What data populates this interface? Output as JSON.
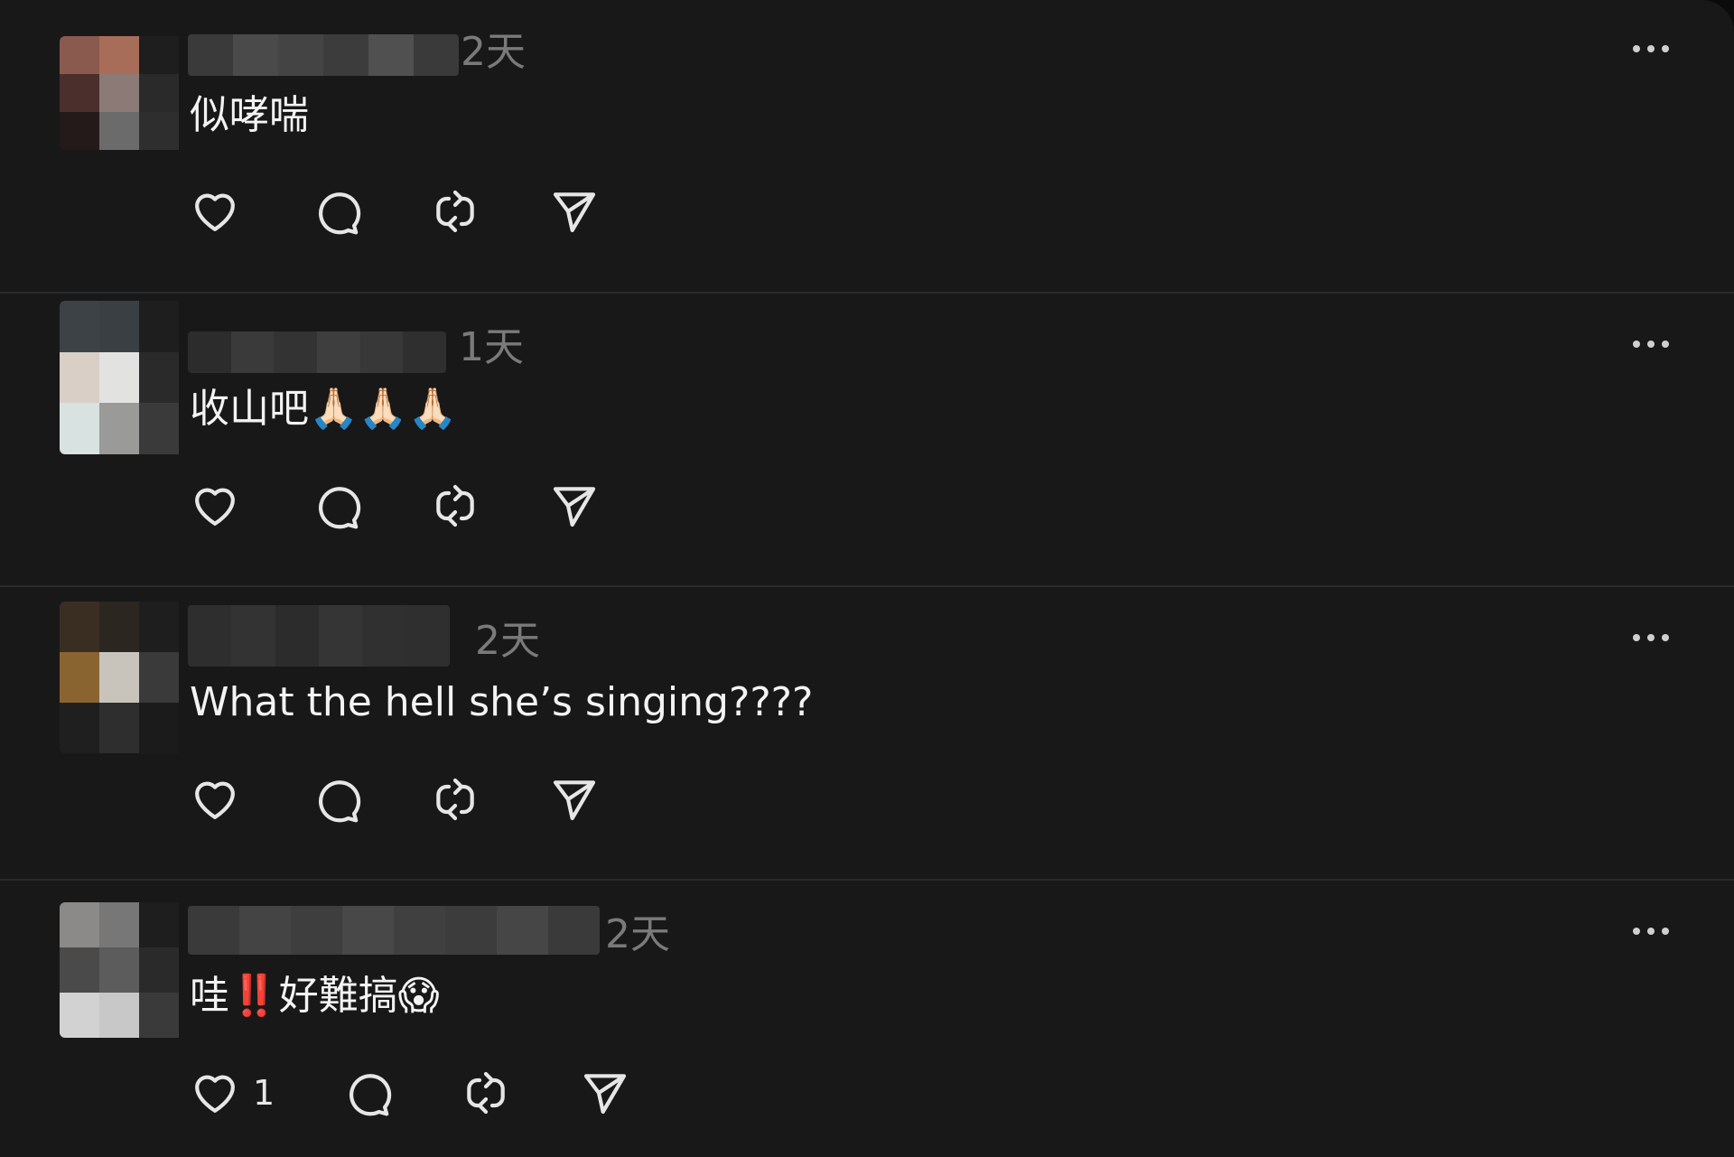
{
  "colors": {
    "background": "#181818",
    "text": "#f3f3f3",
    "muted": "#7a7a7a",
    "divider": "#2a2a2a",
    "icon": "#e6e6e6"
  },
  "posts": [
    {
      "time": "2天",
      "text": "似哮喘",
      "like_count": ""
    },
    {
      "time": "1天",
      "text": "收山吧🙏🏻🙏🏻🙏🏻",
      "like_count": ""
    },
    {
      "time": "2天",
      "text": "What the hell she’s singing????",
      "like_count": ""
    },
    {
      "time": "2天",
      "text_parts": [
        "哇",
        "‼️",
        "好難搞😱"
      ],
      "like_count": "1"
    }
  ],
  "icons": {
    "like": "heart-icon",
    "reply": "comment-bubble-icon",
    "repost": "repost-arrows-icon",
    "share": "send-icon",
    "more": "more-options-icon",
    "avatar": "avatar-pixelated"
  }
}
